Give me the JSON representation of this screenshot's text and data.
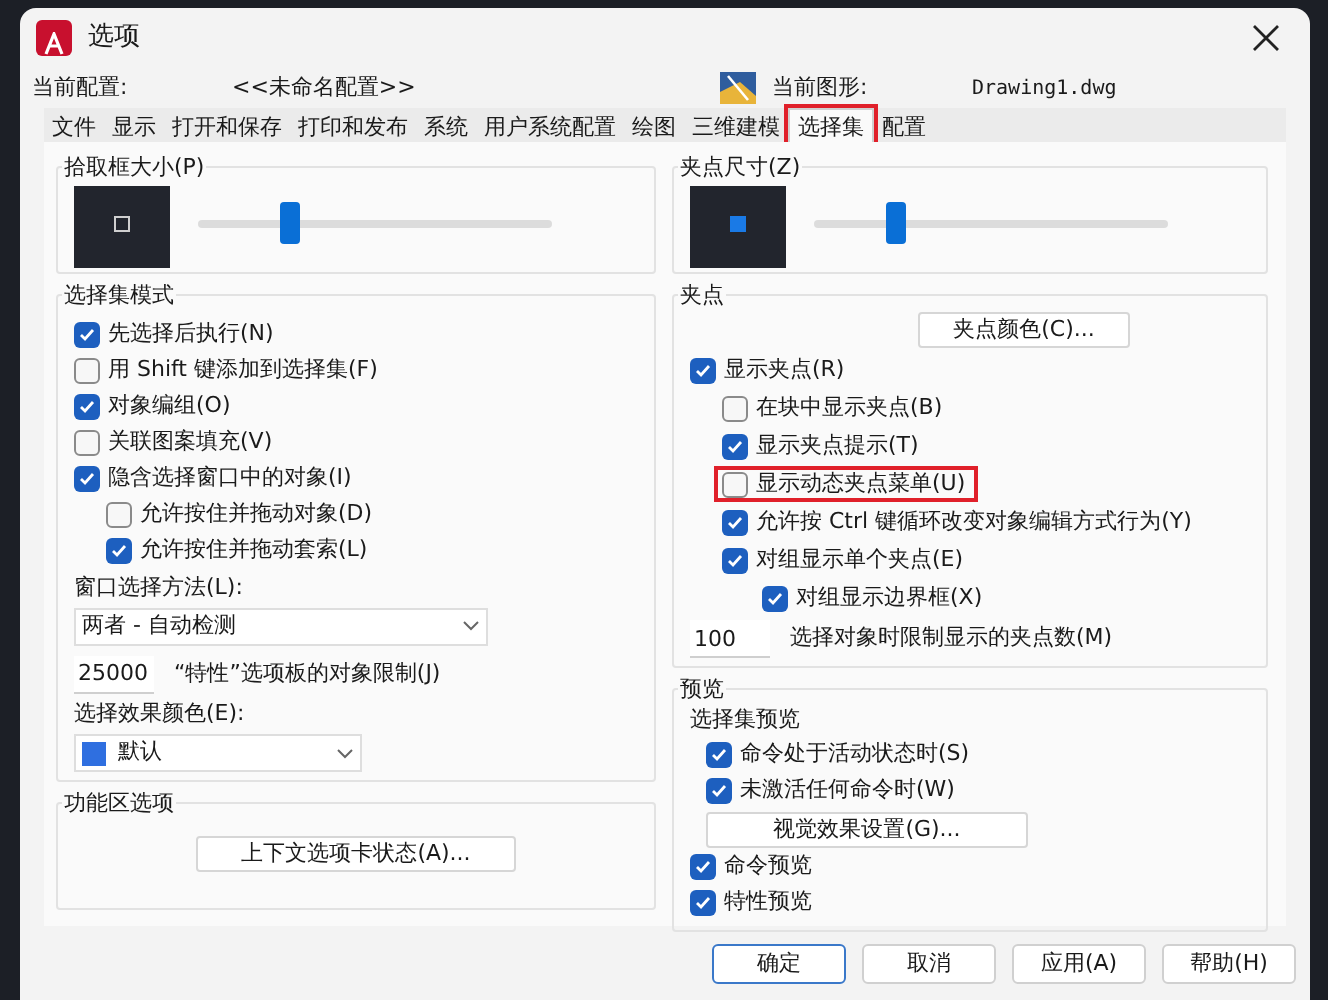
{
  "window": {
    "title": "选项"
  },
  "profile": {
    "label": "当前配置:",
    "value": "<<未命名配置>>",
    "drawing_label": "当前图形:",
    "drawing_value": "Drawing1.dwg"
  },
  "tabs": [
    {
      "label": "文件",
      "selected": false,
      "highlighted": false
    },
    {
      "label": "显示",
      "selected": false,
      "highlighted": false
    },
    {
      "label": "打开和保存",
      "selected": false,
      "highlighted": false
    },
    {
      "label": "打印和发布",
      "selected": false,
      "highlighted": false
    },
    {
      "label": "系统",
      "selected": false,
      "highlighted": false
    },
    {
      "label": "用户系统配置",
      "selected": false,
      "highlighted": false
    },
    {
      "label": "绘图",
      "selected": false,
      "highlighted": false
    },
    {
      "label": "三维建模",
      "selected": false,
      "highlighted": false
    },
    {
      "label": "选择集",
      "selected": true,
      "highlighted": true
    },
    {
      "label": "配置",
      "selected": false,
      "highlighted": false
    }
  ],
  "pickbox": {
    "title": "拾取框大小(P)",
    "level": 0.26
  },
  "selection_modes": {
    "title": "选择集模式",
    "options": [
      {
        "label": "先选择后执行(N)",
        "checked": true
      },
      {
        "label": "用 Shift 键添加到选择集(F)",
        "checked": false
      },
      {
        "label": "对象编组(O)",
        "checked": true
      },
      {
        "label": "关联图案填充(V)",
        "checked": false
      },
      {
        "label": "隐含选择窗口中的对象(I)",
        "checked": true,
        "children": [
          {
            "label": "允许按住并拖动对象(D)",
            "checked": false
          },
          {
            "label": "允许按住并拖动套索(L)",
            "checked": true
          }
        ]
      }
    ],
    "window_method_label": "窗口选择方法(L):",
    "window_method": "两者 - 自动检测",
    "object_limit": "25000",
    "object_limit_label": "“特性”选项板的对象限制(J)",
    "effect_color_label": "选择效果颜色(E):",
    "effect_color": {
      "name": "默认",
      "color": "#2f6fe0"
    }
  },
  "ribbon": {
    "title": "功能区选项",
    "button": "上下文选项卡状态(A)..."
  },
  "grip_size": {
    "title": "夹点尺寸(Z)",
    "level": 0.23
  },
  "grips": {
    "title": "夹点",
    "color_button": "夹点颜色(C)...",
    "options": [
      {
        "label": "显示夹点(R)",
        "checked": true,
        "highlighted": false,
        "children": [
          {
            "label": "在块中显示夹点(B)",
            "checked": false,
            "highlighted": false
          },
          {
            "label": "显示夹点提示(T)",
            "checked": true,
            "highlighted": false
          },
          {
            "label": "显示动态夹点菜单(U)",
            "checked": false,
            "highlighted": true
          },
          {
            "label": "允许按 Ctrl 键循环改变对象编辑方式行为(Y)",
            "checked": true,
            "highlighted": false
          },
          {
            "label": "对组显示单个夹点(E)",
            "checked": true,
            "highlighted": false,
            "children": [
              {
                "label": "对组显示边界框(X)",
                "checked": true,
                "highlighted": false
              }
            ]
          }
        ]
      }
    ],
    "limit": "100",
    "limit_label": "选择对象时限制显示的夹点数(M)"
  },
  "preview": {
    "title": "预览",
    "subtitle": "选择集预览",
    "options": [
      {
        "label": "命令处于活动状态时(S)",
        "checked": true
      },
      {
        "label": "未激活任何命令时(W)",
        "checked": true
      }
    ],
    "effects_button": "视觉效果设置(G)...",
    "more": [
      {
        "label": "命令预览",
        "checked": true
      },
      {
        "label": "特性预览",
        "checked": true
      }
    ]
  },
  "buttons": [
    "确定",
    "取消",
    "应用(A)",
    "帮助(H)"
  ]
}
